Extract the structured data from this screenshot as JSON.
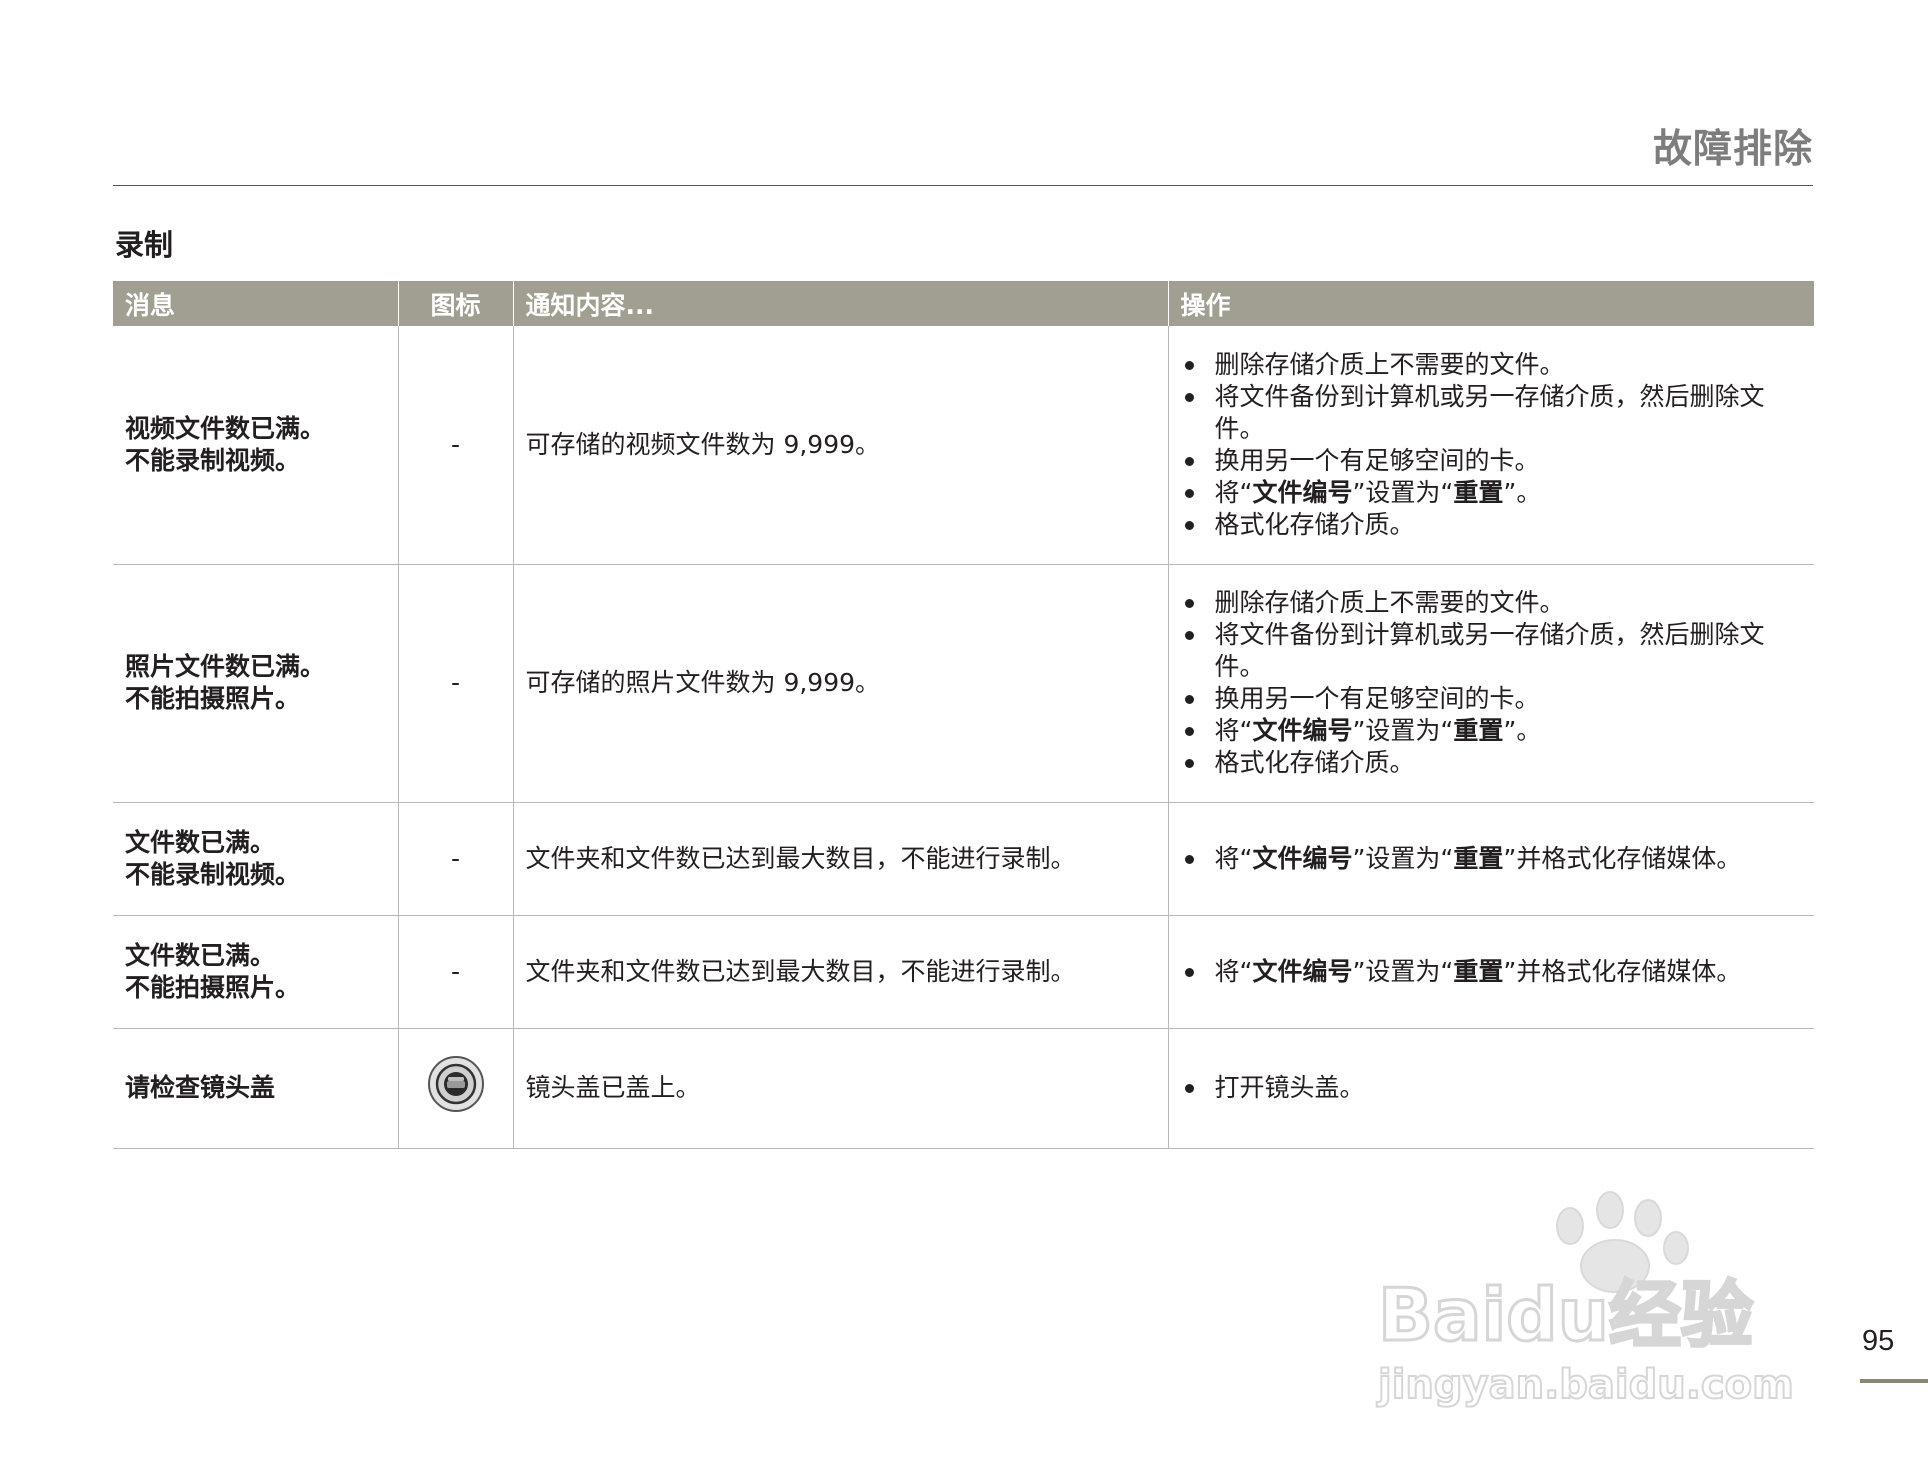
{
  "header": {
    "chapter_title": "故障排除"
  },
  "section": {
    "title": "录制"
  },
  "table": {
    "columns": [
      "消息",
      "图标",
      "通知内容...",
      "操作"
    ],
    "rows": [
      {
        "message_lines": [
          "视频文件数已满。",
          "不能录制视频。"
        ],
        "icon": "-",
        "content": "可存储的视频文件数为 9,999。",
        "actions": [
          {
            "text": "删除存储介质上不需要的文件。"
          },
          {
            "text": "将文件备份到计算机或另一存储介质，然后删除文件。"
          },
          {
            "text": "换用另一个有足够空间的卡。"
          },
          {
            "pre": "将“",
            "b1": "文件编号",
            "mid": "”设置为“",
            "b2": "重置",
            "post": "”。"
          },
          {
            "text": "格式化存储介质。"
          }
        ]
      },
      {
        "message_lines": [
          "照片文件数已满。",
          "不能拍摄照片。"
        ],
        "icon": "-",
        "content": "可存储的照片文件数为 9,999。",
        "actions": [
          {
            "text": "删除存储介质上不需要的文件。"
          },
          {
            "text": "将文件备份到计算机或另一存储介质，然后删除文件。"
          },
          {
            "text": "换用另一个有足够空间的卡。"
          },
          {
            "pre": "将“",
            "b1": "文件编号",
            "mid": "”设置为“",
            "b2": "重置",
            "post": "”。"
          },
          {
            "text": "格式化存储介质。"
          }
        ]
      },
      {
        "message_lines": [
          "文件数已满。",
          "不能录制视频。"
        ],
        "icon": "-",
        "content": "文件夹和文件数已达到最大数目，不能进行录制。",
        "actions": [
          {
            "pre": "将“",
            "b1": "文件编号",
            "mid": "”设置为“",
            "b2": "重置",
            "post": "”并格式化存储媒体。"
          }
        ]
      },
      {
        "message_lines": [
          "文件数已满。",
          "不能拍摄照片。"
        ],
        "icon": "-",
        "content": "文件夹和文件数已达到最大数目，不能进行录制。",
        "actions": [
          {
            "pre": "将“",
            "b1": "文件编号",
            "mid": "”设置为“",
            "b2": "重置",
            "post": "”并格式化存储媒体。"
          }
        ]
      },
      {
        "message_lines": [
          "请检查镜头盖"
        ],
        "icon": "lens-cover-icon",
        "content": "镜头盖已盖上。",
        "actions": [
          {
            "text": "打开镜头盖。"
          }
        ]
      }
    ]
  },
  "watermark": {
    "logo_text": "Baidu经验",
    "url": "jingyan.baidu.com"
  },
  "footer": {
    "page_number": "95"
  },
  "colors": {
    "header_bg": "#a19f91",
    "chapter_title": "#7d7d7d",
    "page_rule": "#8b8573"
  }
}
